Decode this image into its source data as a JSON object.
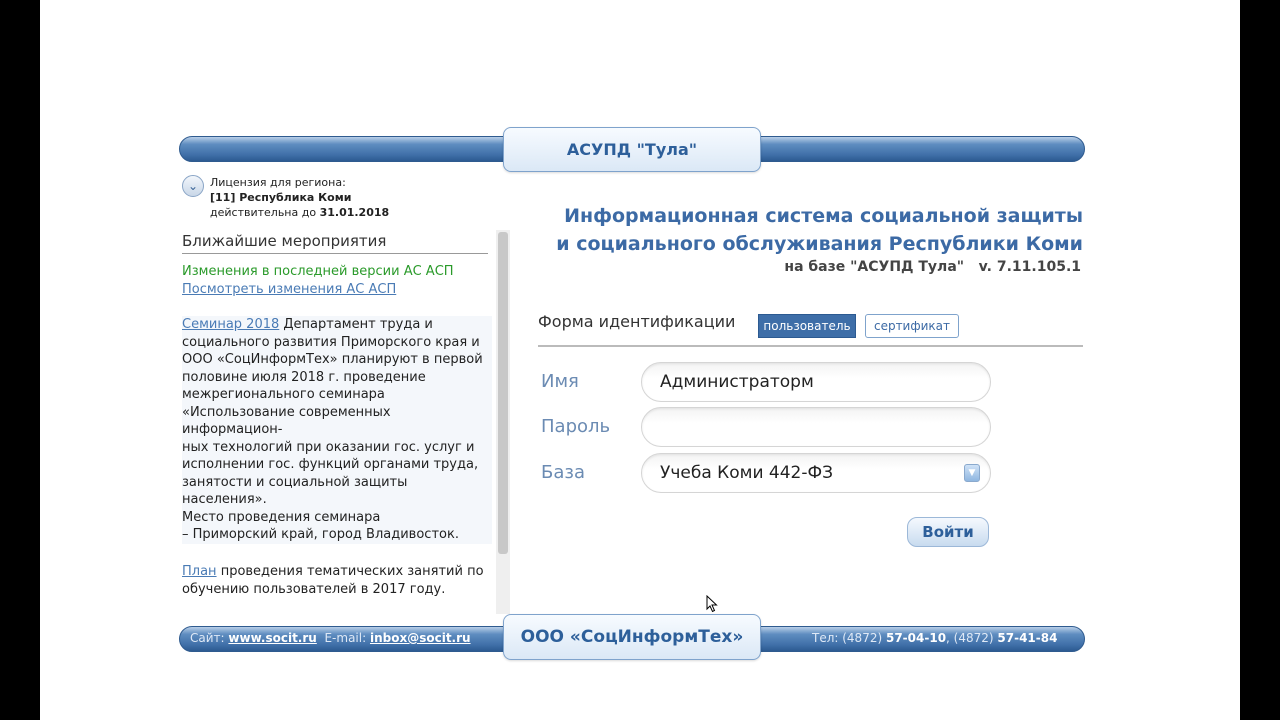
{
  "header": {
    "title": "АСУПД \"Тула\""
  },
  "license": {
    "label": "Лицензия для региона:",
    "region": "[11] Республика Коми",
    "valid_prefix": "действительна до",
    "valid_date": "31.01.2018"
  },
  "events": {
    "title": "Ближайшие мероприятия",
    "changes_text": "Изменения в последней версии АС АСП",
    "changes_link": "Посмотреть изменения АС АСП",
    "seminar_link": "Семинар 2018",
    "seminar_text": " Департамент труда и социального развития Приморского края и ООО «СоцИнформТех» планируют в первой половине июля 2018 г. проведение межрегионального семинара «Использование современных информацион-",
    "seminar_text2": "ных технологий при оказании гос. услуг и исполнении гос. функций органами труда, занятости и социальной защиты населения».",
    "seminar_place_label": "Место проведения семинара",
    "seminar_place": "– Приморский край, город Владивосток.",
    "plan_link": "План",
    "plan_text": " проведения тематических занятий по обучению пользователей в 2017 году."
  },
  "system": {
    "title_line1": "Информационная система социальной защиты",
    "title_line2": "и социального обслуживания Республики Коми",
    "subtitle": "на базе \"АСУПД Тула\"   v. 7.11.105.1"
  },
  "form": {
    "title": "Форма идентификации",
    "tab_user": "пользователь",
    "tab_cert": "сертификат",
    "name_label": "Имя",
    "name_value": "Администраторм",
    "password_label": "Пароль",
    "password_value": "",
    "base_label": "База",
    "base_value": "Учеба Коми 442-ФЗ",
    "login_button": "Войти"
  },
  "footer": {
    "site_label": "Сайт:",
    "site": "www.socit.ru",
    "email_label": "E-mail:",
    "email": "inbox@socit.ru",
    "company": "ООО «СоцИнформТех»",
    "phone_label": "Тел: (4872)",
    "phone1": "57-04-10",
    "phone_sep": ", (4872)",
    "phone2": "57-41-84"
  }
}
